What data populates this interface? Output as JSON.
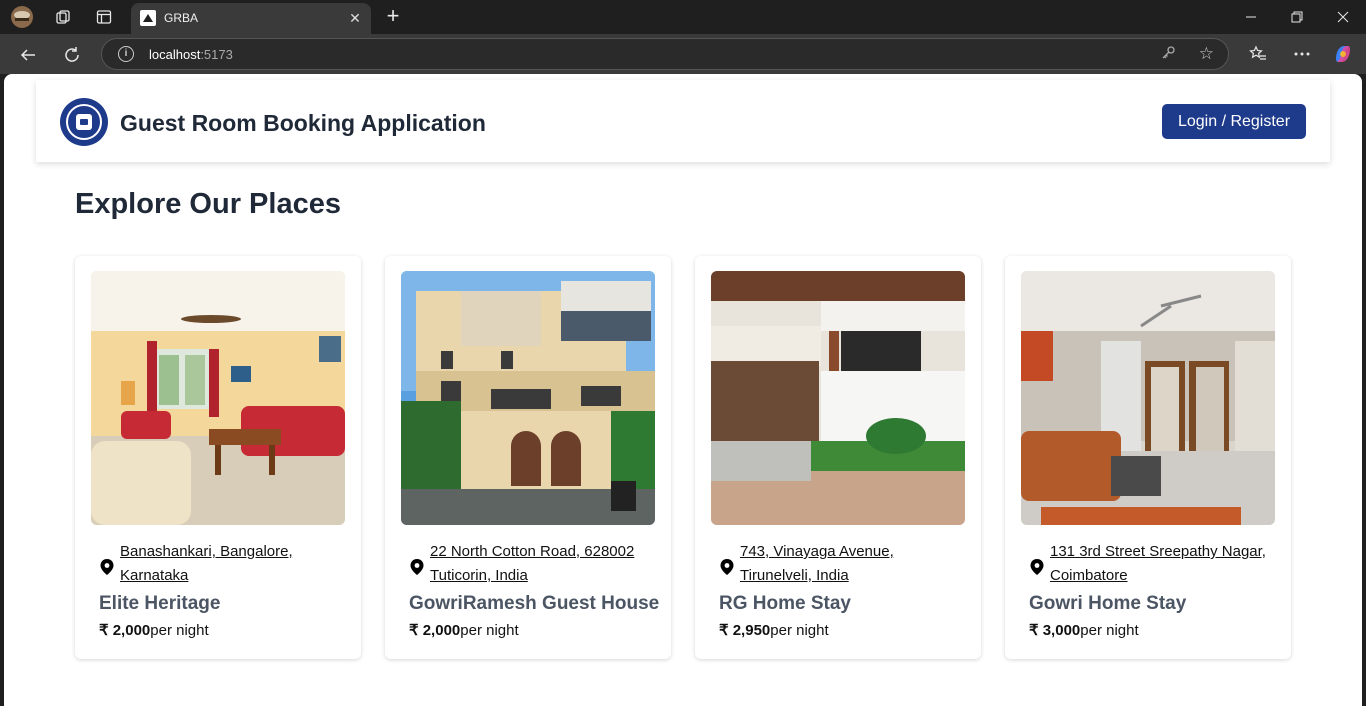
{
  "browser": {
    "tab_title": "GRBA",
    "url_host": "localhost",
    "url_port": ":5173"
  },
  "header": {
    "app_title": "Guest Room Booking Application",
    "login_label": "Login / Register"
  },
  "main": {
    "section_title": "Explore Our Places",
    "currency": "₹",
    "price_suffix": "per night",
    "places": [
      {
        "address_line1": "Banashankari, Bangalore,",
        "address_line2": "Karnataka",
        "name": "Elite Heritage",
        "price": "2,000"
      },
      {
        "address_line1": "22 North Cotton Road, 628002",
        "address_line2": "Tuticorin, India",
        "name": "GowriRamesh Guest House",
        "price": "2,000"
      },
      {
        "address_line1": "743, Vinayaga Avenue,",
        "address_line2": "Tirunelveli, India",
        "name": "RG Home Stay",
        "price": "2,950"
      },
      {
        "address_line1": "131 3rd Street Sreepathy Nagar,",
        "address_line2": "Coimbatore",
        "name": "Gowri Home Stay",
        "price": "3,000"
      }
    ]
  },
  "colors": {
    "brand": "#1e3a8a",
    "name_text": "#4b5563"
  },
  "icons": [
    "profile-icon",
    "workspaces-icon",
    "tab-actions-icon",
    "new-tab-icon",
    "back-icon",
    "reload-icon",
    "site-info-icon",
    "password-key-icon",
    "star-icon",
    "favorites-icon",
    "more-icon",
    "copilot-icon",
    "location-pin-icon"
  ]
}
